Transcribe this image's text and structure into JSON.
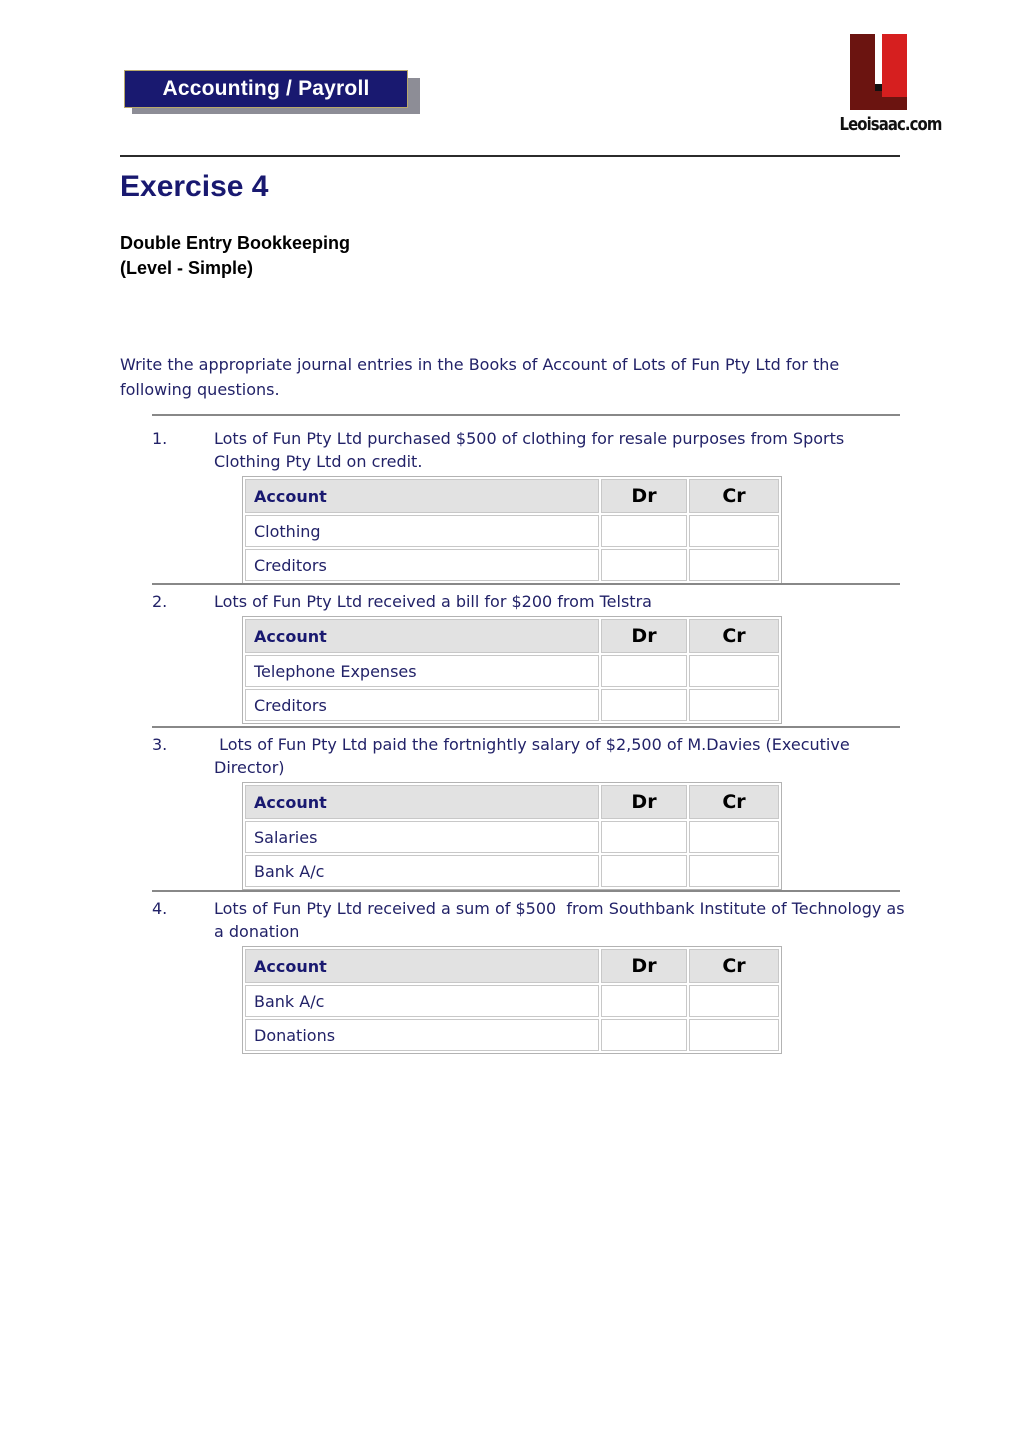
{
  "header": {
    "banner_label": "Accounting / Payroll",
    "logo_wordmark": "Leoisaac.com",
    "logo_icon_name": "leoisaac-l-logo",
    "banner_color": "#191970",
    "logo_dark_red": "#6b1410",
    "logo_bright_red": "#d61f1f"
  },
  "title": {
    "heading": "Exercise 4",
    "subtitle_line1": "Double Entry Bookkeeping",
    "subtitle_line2": "(Level - Simple)",
    "heading_color": "#191970"
  },
  "intro": {
    "text": "Write the appropriate journal entries in the Books of Account of Lots of Fun Pty Ltd for the following questions."
  },
  "table_headers": {
    "account": "Account",
    "dr": "Dr",
    "cr": "Cr"
  },
  "questions": [
    {
      "number": "1.",
      "text": "Lots of Fun Pty Ltd purchased $500 of clothing for resale purposes from Sports Clothing Pty Ltd on credit.",
      "rows": [
        {
          "account": "Clothing",
          "dr": "",
          "cr": ""
        },
        {
          "account": "Creditors",
          "dr": "",
          "cr": ""
        }
      ]
    },
    {
      "number": "2.",
      "text": "Lots of Fun Pty Ltd received a bill for $200 from Telstra",
      "rows": [
        {
          "account": "Telephone Expenses",
          "dr": "",
          "cr": ""
        },
        {
          "account": "Creditors",
          "dr": "",
          "cr": ""
        }
      ]
    },
    {
      "number": "3.",
      "text": " Lots of Fun Pty Ltd paid the fortnightly salary of $2,500 of M.Davies (Executive Director)",
      "rows": [
        {
          "account": "Salaries",
          "dr": "",
          "cr": ""
        },
        {
          "account": "Bank A/c",
          "dr": "",
          "cr": ""
        }
      ]
    },
    {
      "number": "4.",
      "text": "Lots of Fun Pty Ltd received a sum of $500  from Southbank Institute of Technology as a donation",
      "rows": [
        {
          "account": "Bank A/c",
          "dr": "",
          "cr": ""
        },
        {
          "account": "Donations",
          "dr": "",
          "cr": ""
        }
      ]
    }
  ]
}
